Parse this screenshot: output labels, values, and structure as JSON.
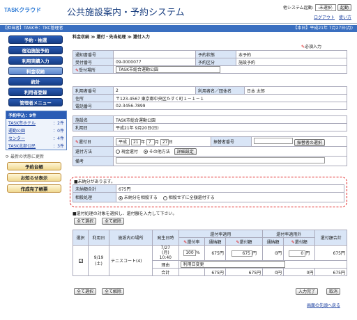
{
  "header": {
    "logo": "TASK",
    "logo_sub": "クラウド",
    "system_name": "公共施設案内・予約システム",
    "other_system_label": "他システム起動:",
    "other_system_select": "-未選択-",
    "launch_button": "起動",
    "logout": "ログアウト",
    "help": "使い方"
  },
  "bar": {
    "left": "【担当者】TASK市：TKC管理者",
    "right": "【本日】平成21年 7月27日(月)"
  },
  "sidebar": {
    "menu": [
      "予約・抽選",
      "宿泊施設予約",
      "利用実績入力",
      "料金収納",
      "統計",
      "利用者登録",
      "管理者メニュー"
    ],
    "requests_title": "予約申込：9件",
    "requests": [
      {
        "name": "TASK市ホテル",
        "count": "：2件"
      },
      {
        "name": "運動公園",
        "count": "：0件"
      },
      {
        "name": "センター",
        "count": "：4件"
      },
      {
        "name": "TASK北部公民",
        "count": "：3件"
      }
    ],
    "refresh": "最新の状態に更新",
    "buttons": [
      "予約台帳",
      "お知らせ表示",
      "作成完了帳票"
    ]
  },
  "breadcrumb": "料金収納 ≫ 還付・先当処理 ≫ 還付入力",
  "required_note": "必須入力",
  "form1": {
    "notice_no_label": "通知書番号",
    "notice_no": "",
    "reserve_status_label": "予約状態",
    "reserve_status": "本予約",
    "accept_no_label": "受付番号",
    "accept_no": "09-0000077",
    "reserve_type_label": "予約区分",
    "reserve_type": "施設予約",
    "place_label": "受付場所",
    "place": "TASK市総合運動公園"
  },
  "form2": {
    "user_no_label": "利用者番号",
    "user_no": "2",
    "user_name_label": "利用者名／団体名",
    "user_name": "日本 太郎",
    "address_label": "住所",
    "address": "〒123-4567 東京都中央区たすく町１－１－１",
    "phone_label": "電話番号",
    "phone": "02-3456-7899"
  },
  "form3": {
    "facility_label": "施設名",
    "facility": "TASK市総合運動公園",
    "date_label": "利用日",
    "date": "平成21年 9月20日(日)"
  },
  "form4": {
    "refund_date_label": "還付日",
    "era": "平成",
    "year": "21",
    "month": "7",
    "day": "27",
    "year_u": "年",
    "month_u": "月",
    "day_u": "日",
    "payer_label": "振替者番号",
    "payer_button": "振替者の選択",
    "method_label": "還付方法",
    "method_cash": "現金還付",
    "method_other": "その他方法",
    "detail_button": "詳細設定",
    "remarks_label": "備考"
  },
  "warning": {
    "title": "■未納分があります。",
    "unpaid_label": "未納額合計",
    "unpaid": "675円",
    "offset_label": "相殺処理",
    "opt1": "未納分を相殺する",
    "opt2": "相殺せずに全額還付する"
  },
  "table_hint": "■還付処理の対象を選択し、還付額を入力して下さい。",
  "select_all": "全て選択",
  "clear_all": "全て解除",
  "table": {
    "h_select": "選択",
    "h_date": "利用日",
    "h_place": "施設内の場所",
    "h_occur": "発生日時",
    "h_tax": "還付率適用",
    "h_notax": "還付率適用外",
    "h_total": "還付額合計",
    "h_rate": "還付率",
    "h_paid": "通納額",
    "h_refund": "還付額",
    "row": {
      "date": "9/19\n(土)",
      "place": "テニスコート(4)",
      "occur": "7/27\n(月)\n10:40",
      "rate": "100",
      "pct": "%",
      "paid": "675円",
      "refund": "675",
      "yen": "円",
      "paid2": "0円",
      "refund2": "0",
      "total": "675円"
    },
    "reason_label": "理由",
    "reason": "利用日変更",
    "sum_label": "合計",
    "sum1": "675円",
    "sum2": "675円",
    "sum3": "0円",
    "sum4": "0円",
    "sum_total": "675円"
  },
  "footer": {
    "done": "入力完了",
    "cancel": "取消",
    "top": "画面の先頭へ戻る"
  }
}
